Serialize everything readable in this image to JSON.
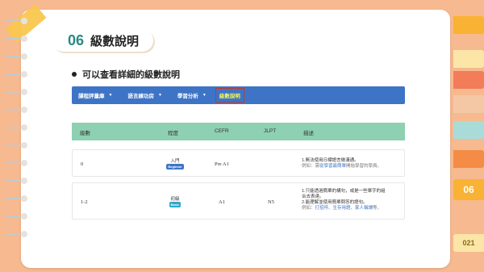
{
  "section": {
    "number": "06",
    "title": "級數說明"
  },
  "subtitle": "可以查看詳細的級數說明",
  "nav": {
    "items": [
      {
        "label": "課程評量庫",
        "caret": "▼"
      },
      {
        "label": "語言練功房",
        "caret": "▼"
      },
      {
        "label": "學習分析",
        "caret": "▼"
      }
    ],
    "active": "級數說明"
  },
  "table": {
    "headers": [
      "級數",
      "程度",
      "CEFR",
      "JLPT",
      "描述"
    ],
    "rows": [
      {
        "level": "0",
        "degree": "入門",
        "badge": "Beginner",
        "cefr": "Pre A1",
        "jlpt": "",
        "desc_line1": "1.無法使用日標語言做溝通。",
        "desc_ex_prefix": "例如：需",
        "desc_ex_hl": "從學習最簡單",
        "desc_ex_suffix": "開始學習的學員。"
      },
      {
        "level": "1-2",
        "degree": "初級",
        "badge": "Basic",
        "cefr": "A1",
        "jlpt": "N5",
        "desc_line1": "1.只能透過簡單的構句，或是一些單字的組",
        "desc_line2": "合去表達。",
        "desc_line3": "2.能理解並使用簡單問答的語句。",
        "desc_ex_prefix": "例如：",
        "desc_ex_hl": "打招呼、生存用語、家人稱謂",
        "desc_ex_suffix": "等。"
      }
    ]
  },
  "side": {
    "page_tab": "06",
    "slide_num": "021"
  },
  "colors": {
    "accent": "#2a8a7f",
    "nav": "#3e74c6",
    "thead": "#8ed0b2",
    "bg": "#f7b98f"
  }
}
